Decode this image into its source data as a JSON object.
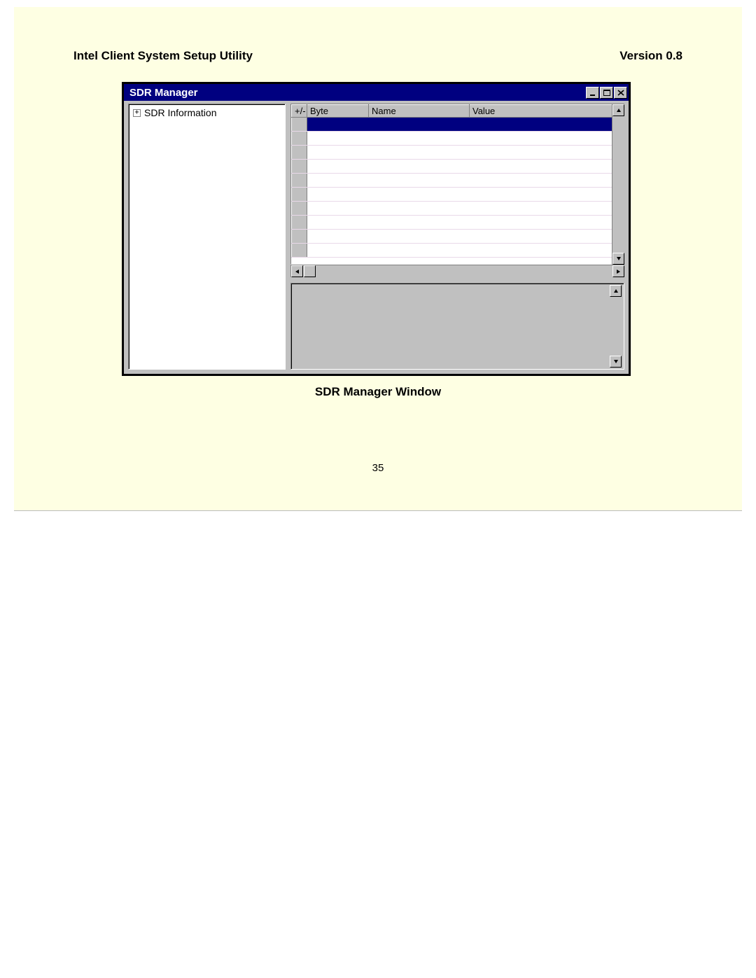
{
  "doc": {
    "title": "Intel Client System Setup Utility",
    "version_label": "Version 0.8",
    "caption": "SDR Manager Window",
    "page_number": "35"
  },
  "window": {
    "title": "SDR Manager"
  },
  "tree": {
    "root_label": "SDR Information",
    "expand_symbol": "+"
  },
  "grid": {
    "columns": {
      "plus_minus": "+/-",
      "byte": "Byte",
      "name": "Name",
      "value": "Value"
    },
    "rows": [
      {
        "selected": true,
        "pm": "",
        "byte": "",
        "name": "",
        "value": ""
      },
      {
        "selected": false,
        "pm": "",
        "byte": "",
        "name": "",
        "value": ""
      },
      {
        "selected": false,
        "pm": "",
        "byte": "",
        "name": "",
        "value": ""
      },
      {
        "selected": false,
        "pm": "",
        "byte": "",
        "name": "",
        "value": ""
      },
      {
        "selected": false,
        "pm": "",
        "byte": "",
        "name": "",
        "value": ""
      },
      {
        "selected": false,
        "pm": "",
        "byte": "",
        "name": "",
        "value": ""
      },
      {
        "selected": false,
        "pm": "",
        "byte": "",
        "name": "",
        "value": ""
      },
      {
        "selected": false,
        "pm": "",
        "byte": "",
        "name": "",
        "value": ""
      },
      {
        "selected": false,
        "pm": "",
        "byte": "",
        "name": "",
        "value": ""
      },
      {
        "selected": false,
        "pm": "",
        "byte": "",
        "name": "",
        "value": ""
      }
    ]
  }
}
